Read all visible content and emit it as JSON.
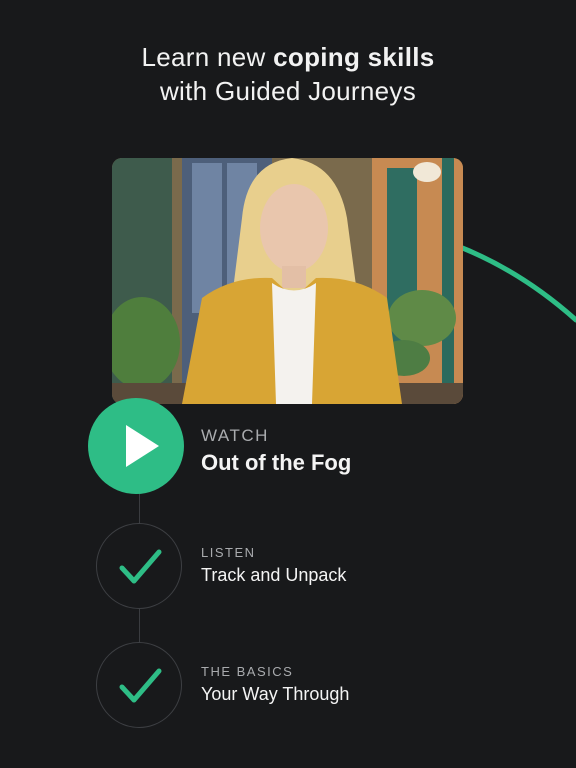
{
  "headline": {
    "line1_prefix": "Learn new ",
    "line1_bold": "coping skills",
    "line2": "with Guided Journeys"
  },
  "colors": {
    "accent": "#2ebd86",
    "background": "#18191b"
  },
  "video": {
    "thumbnail_icon": "video-thumbnail"
  },
  "steps": [
    {
      "kicker": "WATCH",
      "title": "Out of the Fog",
      "state": "active",
      "icon": "play-icon"
    },
    {
      "kicker": "LISTEN",
      "title": "Track and Unpack",
      "state": "done",
      "icon": "checkmark-icon"
    },
    {
      "kicker": "THE BASICS",
      "title": "Your Way Through",
      "state": "done",
      "icon": "checkmark-icon"
    }
  ]
}
